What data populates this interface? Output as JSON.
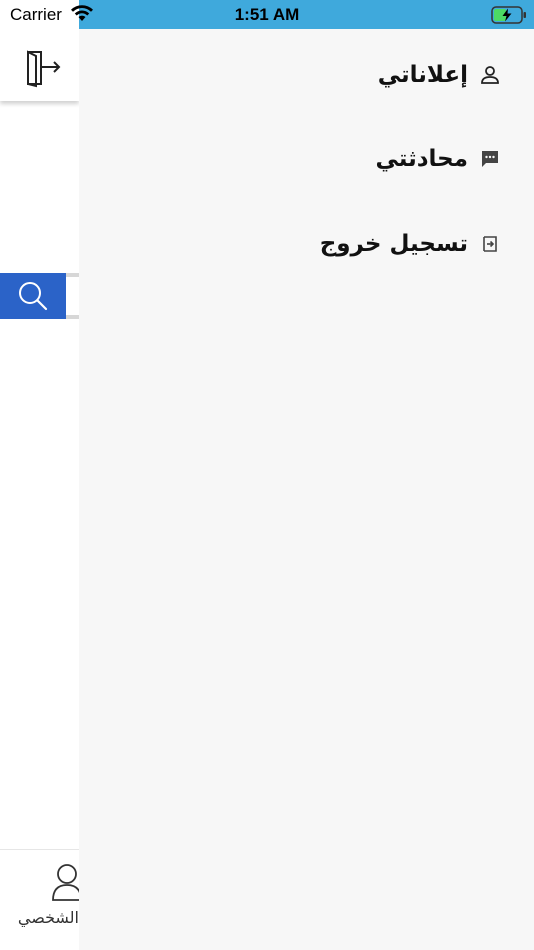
{
  "status_bar": {
    "carrier": "Carrier",
    "time": "1:51 AM",
    "accent_color": "#3fa9dc"
  },
  "under_page": {
    "header_icon": "exit-door-icon",
    "search_icon": "search-icon",
    "search_button_color": "#2b63c8",
    "tab_icon": "person-icon",
    "tab_label": "الشخصي"
  },
  "drawer": {
    "background": "#f7f7f7",
    "items": [
      {
        "label": "إعلاناتي",
        "icon": "person-outline-icon"
      },
      {
        "label": "محادثتي",
        "icon": "chat-icon"
      },
      {
        "label": "تسجيل خروج",
        "icon": "logout-icon"
      }
    ]
  }
}
